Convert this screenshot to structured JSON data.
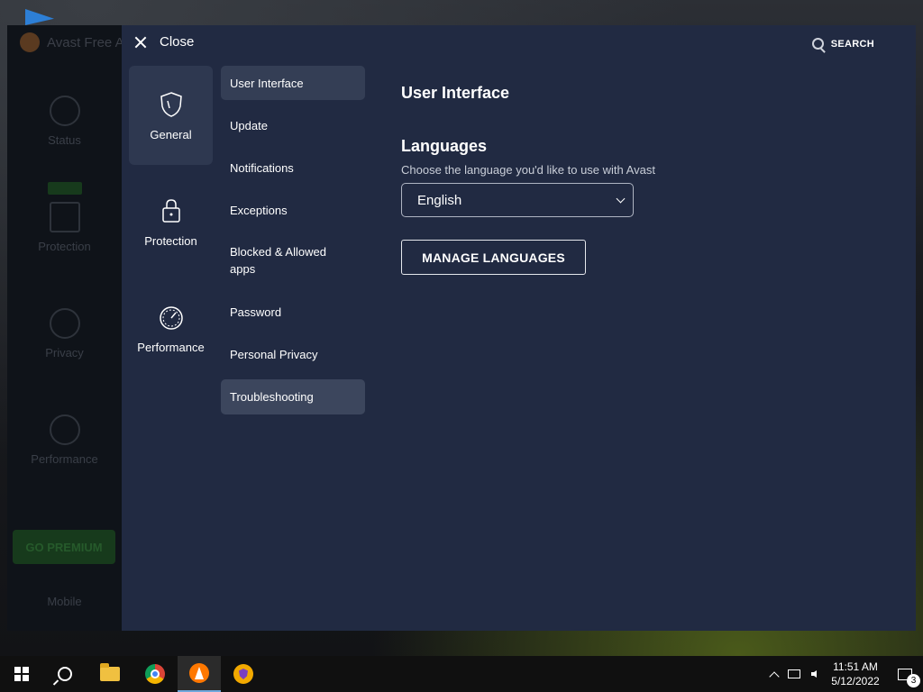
{
  "background_app": {
    "title": "Avast Free A",
    "nav": [
      "Status",
      "Protection",
      "Privacy",
      "Performance"
    ],
    "premium_label": "GO PREMIUM",
    "mobile_label": "Mobile"
  },
  "header": {
    "close_label": "Close",
    "search_label": "SEARCH"
  },
  "categories": [
    {
      "label": "General",
      "icon": "shield-icon",
      "active": true
    },
    {
      "label": "Protection",
      "icon": "lock-icon",
      "active": false
    },
    {
      "label": "Performance",
      "icon": "gauge-icon",
      "active": false
    }
  ],
  "subnav": [
    {
      "label": "User Interface",
      "state": "active"
    },
    {
      "label": "Update"
    },
    {
      "label": "Notifications"
    },
    {
      "label": "Exceptions"
    },
    {
      "label": "Blocked & Allowed apps"
    },
    {
      "label": "Password"
    },
    {
      "label": "Personal Privacy"
    },
    {
      "label": "Troubleshooting",
      "state": "hover"
    }
  ],
  "main": {
    "section_title": "User Interface",
    "languages_title": "Languages",
    "languages_desc": "Choose the language you'd like to use with Avast",
    "selected_language": "English",
    "manage_button": "MANAGE LANGUAGES"
  },
  "taskbar": {
    "apps": [
      "start-icon",
      "search-icon",
      "file-explorer-icon",
      "chrome-icon",
      "avast-icon",
      "avast-secure-browser-icon"
    ],
    "time": "11:51 AM",
    "date": "5/12/2022",
    "notification_count": "3"
  },
  "colors": {
    "panel_bg": "#212a42",
    "active_item_bg": "#343e55",
    "accent_orange": "#ff7800"
  }
}
